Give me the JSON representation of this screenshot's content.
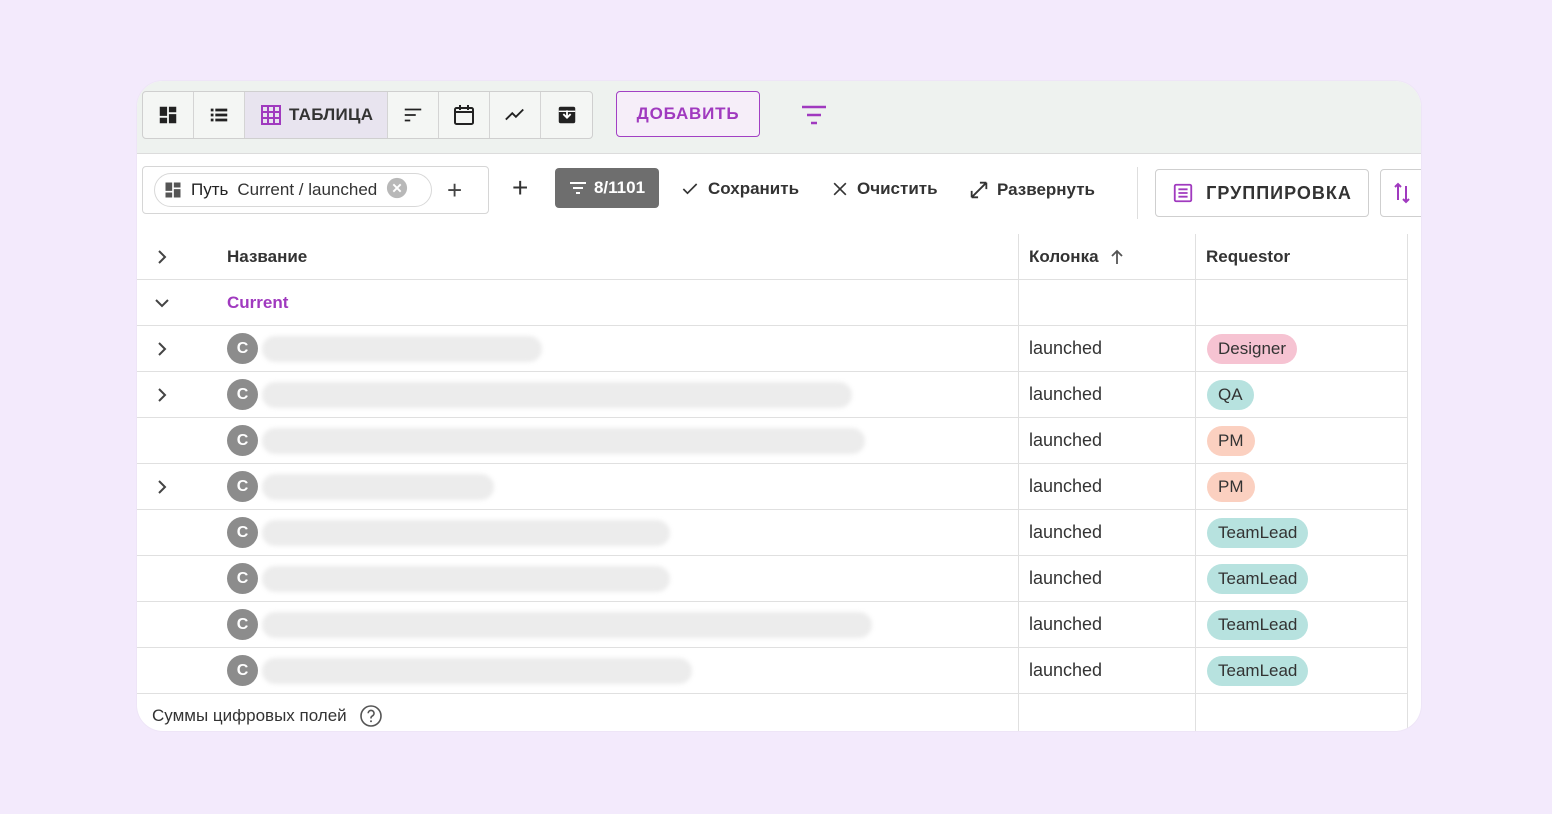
{
  "topbar": {
    "view_table_label": "ТАБЛИЦА",
    "add_label": "ДОБАВИТЬ"
  },
  "toolbar": {
    "chip_key": "Путь",
    "chip_value": "Current / launched",
    "count_label": "8/1101",
    "save_label": "Сохранить",
    "clear_label": "Очистить",
    "expand_label": "Развернуть",
    "group_label": "ГРУППИРОВКА"
  },
  "table": {
    "headers": {
      "name": "Название",
      "column": "Колонка",
      "requestor": "Requestor"
    },
    "group_name": "Current",
    "avatar_letter": "C",
    "rows": [
      {
        "column": "launched",
        "requestor": "Designer"
      },
      {
        "column": "launched",
        "requestor": "QA"
      },
      {
        "column": "launched",
        "requestor": "PM"
      },
      {
        "column": "launched",
        "requestor": "PM"
      },
      {
        "column": "launched",
        "requestor": "TeamLead"
      },
      {
        "column": "launched",
        "requestor": "TeamLead"
      },
      {
        "column": "launched",
        "requestor": "TeamLead"
      },
      {
        "column": "launched",
        "requestor": "TeamLead"
      }
    ],
    "footer_label": "Суммы цифровых полей"
  },
  "colors": {
    "accent": "#a03abf",
    "tag_designer": "#f6c3d2",
    "tag_qa": "#b7e2df",
    "tag_pm": "#fbd0c0",
    "tag_teamlead": "#b7e2df"
  }
}
